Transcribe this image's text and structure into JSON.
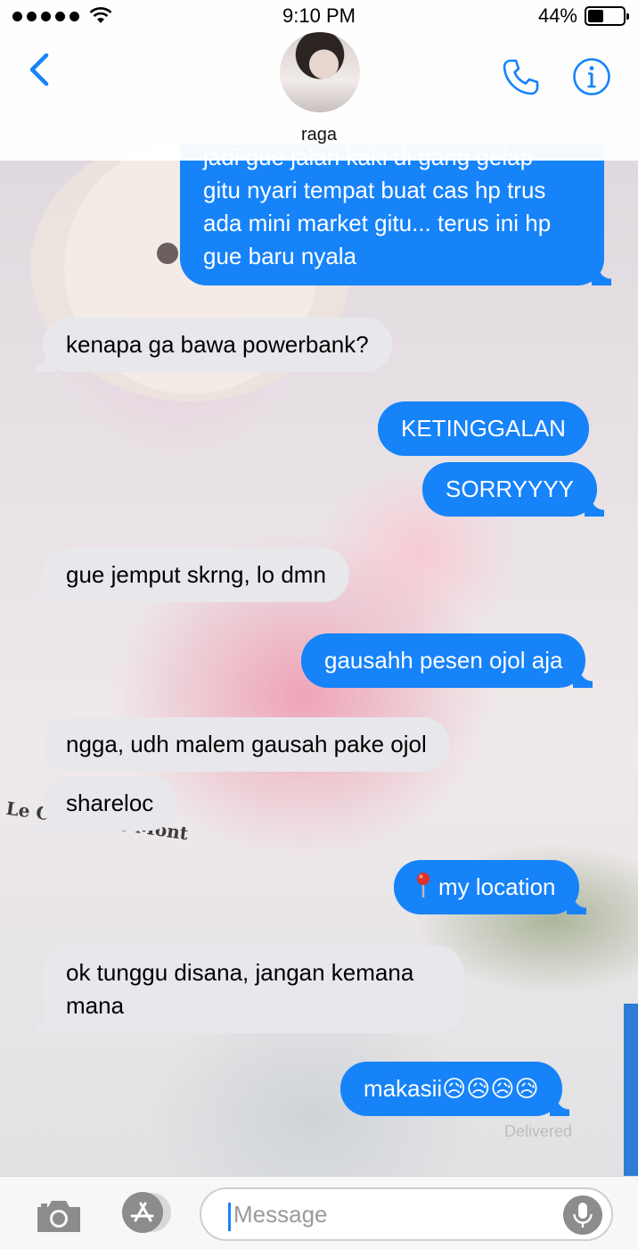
{
  "status_bar": {
    "time": "9:10 PM",
    "battery_percent_label": "44%",
    "battery_level": 0.44,
    "signal_dots": 5
  },
  "header": {
    "contact_name": "raga",
    "back_icon": "chevron-left-icon",
    "call_icon": "phone-icon",
    "info_icon": "info-icon"
  },
  "background_text": {
    "book_title": "Le Comte de Mont"
  },
  "messages": [
    {
      "side": "sent",
      "lines": [
        "jadi gue jalan kaki di gang gelap",
        "gitu nyari tempat buat cas hp trus",
        "ada mini market gitu... terus ini hp",
        "gue baru nyala"
      ]
    },
    {
      "side": "received",
      "lines": [
        "kenapa ga bawa powerbank?"
      ]
    },
    {
      "side": "sent",
      "lines": [
        "KETINGGALAN"
      ]
    },
    {
      "side": "sent",
      "lines": [
        "SORRYYYY"
      ]
    },
    {
      "side": "received",
      "lines": [
        "gue jemput skrng, lo dmn"
      ]
    },
    {
      "side": "sent",
      "lines": [
        "gausahh pesen ojol aja"
      ]
    },
    {
      "side": "received",
      "lines": [
        "ngga, udh malem gausah pake ojol"
      ]
    },
    {
      "side": "received",
      "lines": [
        "shareloc"
      ]
    },
    {
      "side": "sent",
      "lines": [
        "my location"
      ],
      "icon": "map-pin-icon"
    },
    {
      "side": "received",
      "lines": [
        "ok tunggu disana, jangan kemana",
        "mana"
      ]
    },
    {
      "side": "sent",
      "lines": [
        "makasii😥😥😥😥"
      ]
    }
  ],
  "delivered_label": "Delivered",
  "input_bar": {
    "placeholder": "Message",
    "camera_icon": "camera-icon",
    "apps_icon": "app-store-icon",
    "mic_icon": "microphone-icon"
  },
  "colors": {
    "sent_bubble": "#1683f9",
    "received_bubble": "#e8e7ec",
    "accent": "#1683f9"
  }
}
